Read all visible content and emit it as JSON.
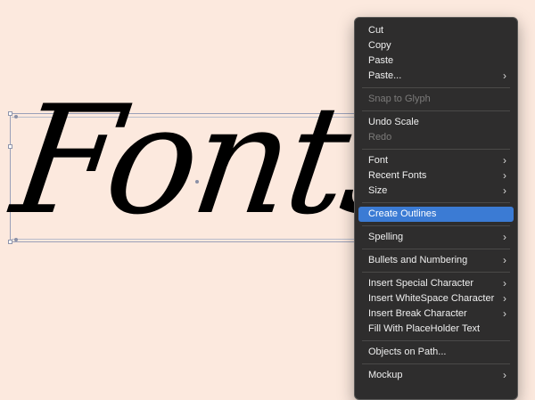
{
  "canvas": {
    "background_color": "#fce9de",
    "text_content": "Fonts"
  },
  "context_menu": {
    "highlight_color": "#3b7bd4",
    "groups": [
      [
        {
          "label": "Cut",
          "enabled": true,
          "submenu": false
        },
        {
          "label": "Copy",
          "enabled": true,
          "submenu": false
        },
        {
          "label": "Paste",
          "enabled": true,
          "submenu": false
        },
        {
          "label": "Paste...",
          "enabled": true,
          "submenu": true
        }
      ],
      [
        {
          "label": "Snap to Glyph",
          "enabled": false,
          "submenu": false
        }
      ],
      [
        {
          "label": "Undo Scale",
          "enabled": true,
          "submenu": false
        },
        {
          "label": "Redo",
          "enabled": false,
          "submenu": false
        }
      ],
      [
        {
          "label": "Font",
          "enabled": true,
          "submenu": true
        },
        {
          "label": "Recent Fonts",
          "enabled": true,
          "submenu": true
        },
        {
          "label": "Size",
          "enabled": true,
          "submenu": true
        }
      ],
      [
        {
          "label": "Create Outlines",
          "enabled": true,
          "submenu": false,
          "highlighted": true
        }
      ],
      [
        {
          "label": "Spelling",
          "enabled": true,
          "submenu": true
        }
      ],
      [
        {
          "label": "Bullets and Numbering",
          "enabled": true,
          "submenu": true
        }
      ],
      [
        {
          "label": "Insert Special Character",
          "enabled": true,
          "submenu": true
        },
        {
          "label": "Insert WhiteSpace Character",
          "enabled": true,
          "submenu": true
        },
        {
          "label": "Insert Break Character",
          "enabled": true,
          "submenu": true
        },
        {
          "label": "Fill With PlaceHolder Text",
          "enabled": true,
          "submenu": false
        }
      ],
      [
        {
          "label": "Objects on Path...",
          "enabled": true,
          "submenu": false
        }
      ],
      [
        {
          "label": "Mockup",
          "enabled": true,
          "submenu": true
        }
      ]
    ],
    "submenu_icon": "chevron-right-icon"
  }
}
